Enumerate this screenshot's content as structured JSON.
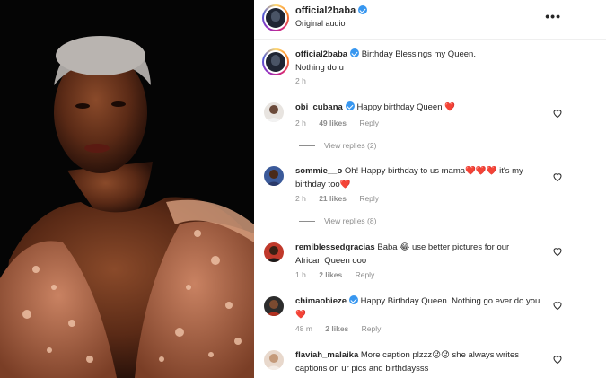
{
  "post": {
    "username": "official2baba",
    "audio": "Original audio",
    "more_label": "•••"
  },
  "caption": {
    "username": "official2baba",
    "text_line1": "Birthday Blessings my Queen.",
    "text_line2": "Nothing do u",
    "time": "2 h"
  },
  "comments": [
    {
      "username": "obi_cubana",
      "verified": true,
      "text_line1": "Happy birthday Queen ❤️",
      "text_line2": "",
      "time": "2 h",
      "likes": "49 likes",
      "reply": "Reply",
      "view_replies": "View replies (2)"
    },
    {
      "username": "sommie__o",
      "verified": false,
      "text_line1": "Oh! Happy birthday to us mama❤️❤️❤️ it's my",
      "text_line2": "birthday too❤️",
      "time": "2 h",
      "likes": "21 likes",
      "reply": "Reply",
      "view_replies": "View replies (8)"
    },
    {
      "username": "remiblessedgracias",
      "verified": false,
      "text_line1": "Baba 😂 use better pictures for our",
      "text_line2": "African Queen ooo",
      "time": "1 h",
      "likes": "2 likes",
      "reply": "Reply"
    },
    {
      "username": "chimaobieze",
      "verified": true,
      "text_line1": "Happy Birthday Queen. Nothing go ever do you",
      "text_line2": "❤️",
      "time": "48 m",
      "likes": "2 likes",
      "reply": "Reply"
    },
    {
      "username": "flaviah_malaika",
      "verified": false,
      "text_line1": "More caption plzzz😟😟 she always writes",
      "text_line2": "captions on ur pics and birthdaysss"
    }
  ],
  "colors": {
    "verified": "#3897f0",
    "heart": "#ed4956",
    "meta": "#8e8e8e"
  },
  "icons": [
    "verified-badge-icon",
    "heart-outline-icon",
    "more-options-icon"
  ]
}
